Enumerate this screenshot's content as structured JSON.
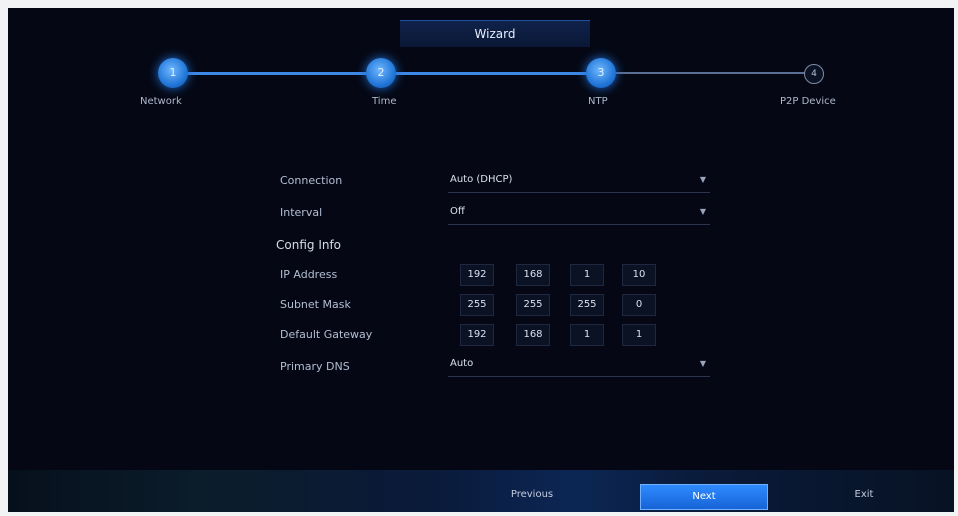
{
  "window": {
    "title": "Wizard"
  },
  "wizard": {
    "steps": [
      {
        "label": "Network",
        "number": "1",
        "state": "done"
      },
      {
        "label": "Time",
        "number": "2",
        "state": "done"
      },
      {
        "label": "NTP",
        "number": "3",
        "state": "current"
      },
      {
        "label": "P2P Device",
        "number": "4",
        "state": "pending"
      }
    ]
  },
  "form": {
    "fields": [
      {
        "label": "Connection",
        "value": "Auto (DHCP)",
        "type": "select"
      },
      {
        "label": "Interval",
        "value": "Off",
        "type": "select"
      }
    ],
    "section_label": "Config Info",
    "ip_rows": [
      {
        "label": "IP Address",
        "octets": [
          "192",
          "168",
          "1",
          "10"
        ]
      },
      {
        "label": "Subnet Mask",
        "octets": [
          "255",
          "255",
          "255",
          "0"
        ]
      },
      {
        "label": "Default Gateway",
        "octets": [
          "192",
          "168",
          "1",
          "1"
        ]
      }
    ],
    "last_field": {
      "label": "Primary DNS",
      "value": "Auto",
      "type": "select"
    }
  },
  "footer": {
    "cancel_label": "Previous",
    "next_label": "Next",
    "exit_label": "Exit"
  },
  "colors": {
    "background": "#050814",
    "accent": "#2277d8"
  }
}
